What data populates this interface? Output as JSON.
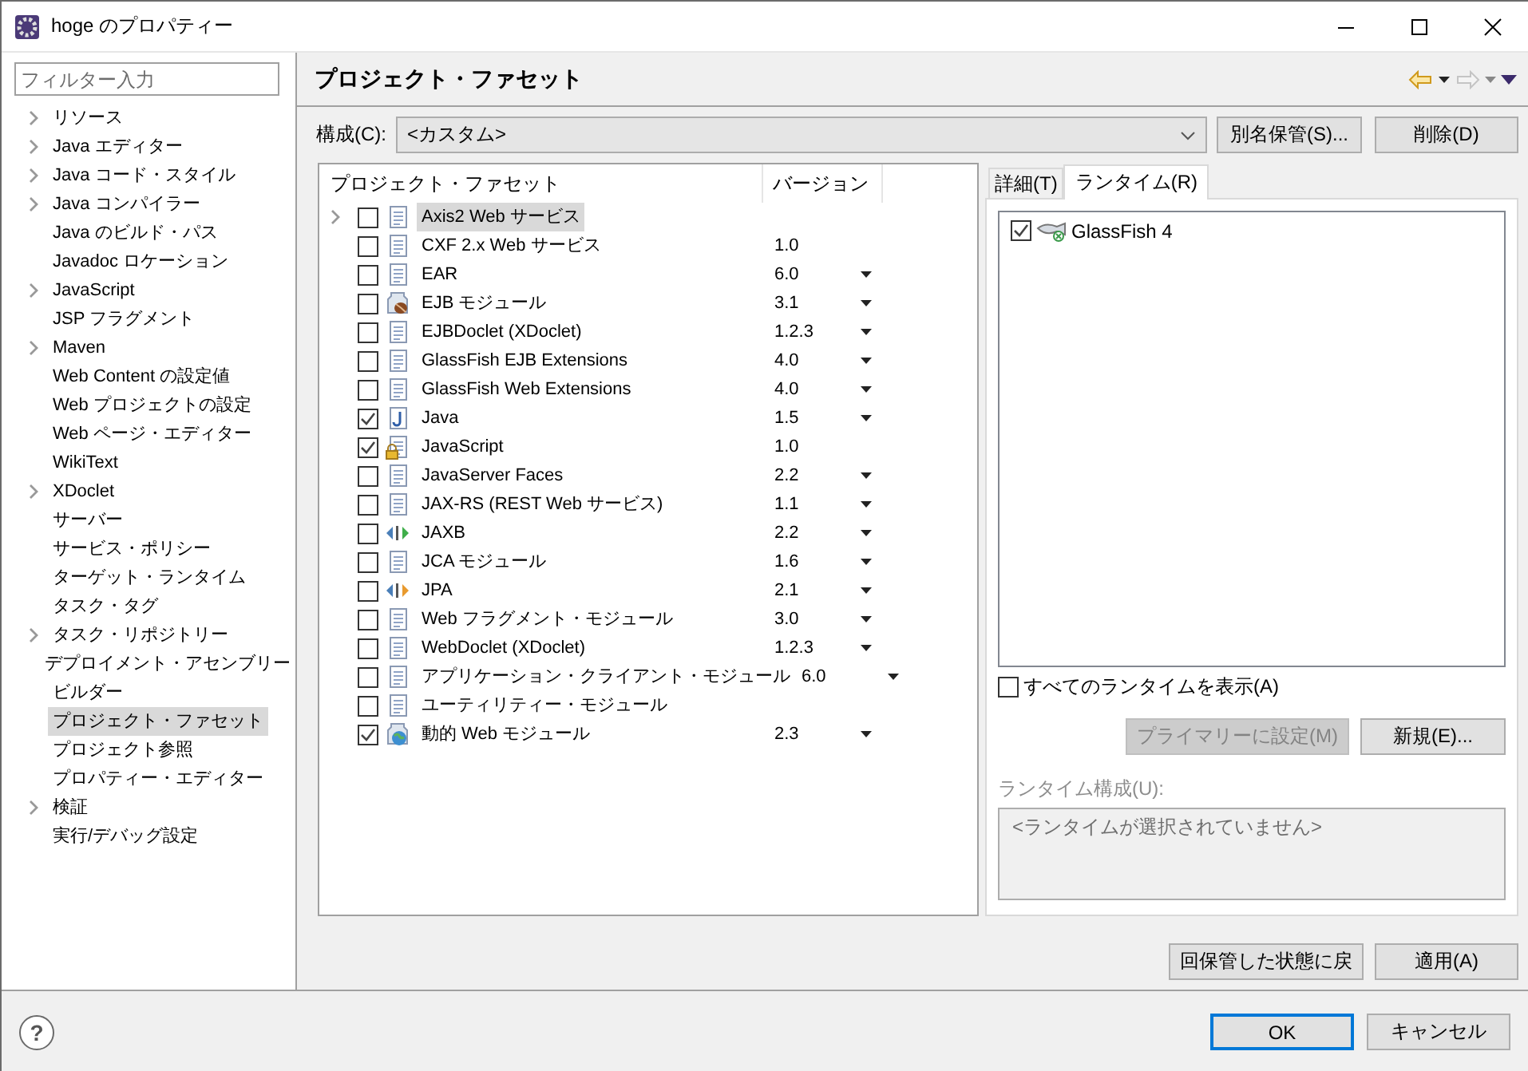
{
  "window": {
    "title": "hoge のプロパティー"
  },
  "sidebar": {
    "filter": {
      "placeholder": "フィルター入力"
    },
    "items": [
      {
        "label": "リソース",
        "expandable": true,
        "selected": false
      },
      {
        "label": "Java エディター",
        "expandable": true,
        "selected": false
      },
      {
        "label": "Java コード・スタイル",
        "expandable": true,
        "selected": false
      },
      {
        "label": "Java コンパイラー",
        "expandable": true,
        "selected": false
      },
      {
        "label": "Java のビルド・パス",
        "expandable": false,
        "selected": false
      },
      {
        "label": "Javadoc ロケーション",
        "expandable": false,
        "selected": false
      },
      {
        "label": "JavaScript",
        "expandable": true,
        "selected": false
      },
      {
        "label": "JSP フラグメント",
        "expandable": false,
        "selected": false
      },
      {
        "label": "Maven",
        "expandable": true,
        "selected": false
      },
      {
        "label": "Web Content の設定値",
        "expandable": false,
        "selected": false
      },
      {
        "label": "Web プロジェクトの設定",
        "expandable": false,
        "selected": false
      },
      {
        "label": "Web ページ・エディター",
        "expandable": false,
        "selected": false
      },
      {
        "label": "WikiText",
        "expandable": false,
        "selected": false
      },
      {
        "label": "XDoclet",
        "expandable": true,
        "selected": false
      },
      {
        "label": "サーバー",
        "expandable": false,
        "selected": false
      },
      {
        "label": "サービス・ポリシー",
        "expandable": false,
        "selected": false
      },
      {
        "label": "ターゲット・ランタイム",
        "expandable": false,
        "selected": false
      },
      {
        "label": "タスク・タグ",
        "expandable": false,
        "selected": false
      },
      {
        "label": "タスク・リポジトリー",
        "expandable": true,
        "selected": false
      },
      {
        "label": "デプロイメント・アセンブリー",
        "expandable": false,
        "selected": false
      },
      {
        "label": "ビルダー",
        "expandable": false,
        "selected": false
      },
      {
        "label": "プロジェクト・ファセット",
        "expandable": false,
        "selected": true
      },
      {
        "label": "プロジェクト参照",
        "expandable": false,
        "selected": false
      },
      {
        "label": "プロパティー・エディター",
        "expandable": false,
        "selected": false
      },
      {
        "label": "検証",
        "expandable": true,
        "selected": false
      },
      {
        "label": "実行/デバッグ設定",
        "expandable": false,
        "selected": false
      }
    ]
  },
  "page": {
    "title": "プロジェクト・ファセット"
  },
  "configuration": {
    "label": "構成(C):",
    "value": "<カスタム>",
    "buttons": [
      {
        "label": "別名保管(S)..."
      },
      {
        "label": "削除(D)"
      }
    ]
  },
  "facets": {
    "columns": [
      "プロジェクト・ファセット",
      "バージョン"
    ],
    "rows": [
      {
        "name": "Axis2 Web サービス",
        "kind": "doc",
        "checked": false,
        "selected": true,
        "expandable": true,
        "has_dropdown": false
      },
      {
        "name": "CXF 2.x Web サービス",
        "version": "1.0",
        "kind": "doc",
        "checked": false,
        "selected": false,
        "expandable": false,
        "has_dropdown": false
      },
      {
        "name": "EAR",
        "version": "6.0",
        "kind": "doc",
        "checked": false,
        "selected": false,
        "expandable": false,
        "has_dropdown": true
      },
      {
        "name": "EJB モジュール",
        "version": "3.1",
        "kind": "bean",
        "checked": false,
        "selected": false,
        "expandable": false,
        "has_dropdown": true
      },
      {
        "name": "EJBDoclet (XDoclet)",
        "version": "1.2.3",
        "kind": "doc",
        "checked": false,
        "selected": false,
        "expandable": false,
        "has_dropdown": true
      },
      {
        "name": "GlassFish EJB Extensions",
        "version": "4.0",
        "kind": "doc",
        "checked": false,
        "selected": false,
        "expandable": false,
        "has_dropdown": true
      },
      {
        "name": "GlassFish Web Extensions",
        "version": "4.0",
        "kind": "doc",
        "checked": false,
        "selected": false,
        "expandable": false,
        "has_dropdown": true
      },
      {
        "name": "Java",
        "version": "1.5",
        "kind": "java",
        "checked": true,
        "selected": false,
        "expandable": false,
        "has_dropdown": true
      },
      {
        "name": "JavaScript",
        "version": "1.0",
        "kind": "locked",
        "checked": true,
        "selected": false,
        "expandable": false,
        "has_dropdown": false
      },
      {
        "name": "JavaServer Faces",
        "version": "2.2",
        "kind": "doc",
        "checked": false,
        "selected": false,
        "expandable": false,
        "has_dropdown": true
      },
      {
        "name": "JAX-RS (REST Web サービス)",
        "version": "1.1",
        "kind": "doc",
        "checked": false,
        "selected": false,
        "expandable": false,
        "has_dropdown": true
      },
      {
        "name": "JAXB",
        "version": "2.2",
        "kind": "arrows_green",
        "checked": false,
        "selected": false,
        "expandable": false,
        "has_dropdown": true
      },
      {
        "name": "JCA モジュール",
        "version": "1.6",
        "kind": "doc",
        "checked": false,
        "selected": false,
        "expandable": false,
        "has_dropdown": true
      },
      {
        "name": "JPA",
        "version": "2.1",
        "kind": "arrows_orange",
        "checked": false,
        "selected": false,
        "expandable": false,
        "has_dropdown": true
      },
      {
        "name": "Web フラグメント・モジュール",
        "version": "3.0",
        "kind": "doc",
        "checked": false,
        "selected": false,
        "expandable": false,
        "has_dropdown": true
      },
      {
        "name": "WebDoclet (XDoclet)",
        "version": "1.2.3",
        "kind": "doc",
        "checked": false,
        "selected": false,
        "expandable": false,
        "has_dropdown": true
      },
      {
        "name": "アプリケーション・クライアント・モジュール",
        "version": "6.0",
        "kind": "doc",
        "checked": false,
        "selected": false,
        "expandable": false,
        "has_dropdown": true
      },
      {
        "name": "ユーティリティー・モジュール",
        "kind": "doc",
        "checked": false,
        "selected": false,
        "expandable": false,
        "has_dropdown": false
      },
      {
        "name": "動的 Web モジュール",
        "version": "2.3",
        "kind": "globe",
        "checked": true,
        "selected": false,
        "expandable": false,
        "has_dropdown": true
      }
    ]
  },
  "details": {
    "tabs": [
      {
        "label": "詳細(T)",
        "selected": false
      },
      {
        "label": "ランタイム(R)",
        "selected": true
      }
    ],
    "runtimes": [
      {
        "name": "GlassFish 4",
        "checked": true
      }
    ],
    "show_all": {
      "label": "すべてのランタイムを表示(A)",
      "checked": false
    },
    "buttons": [
      {
        "label": "プライマリーに設定(M)",
        "disabled": true
      },
      {
        "label": "新規(E)...",
        "disabled": false
      }
    ],
    "runtime_config": {
      "label": "ランタイム構成(U):",
      "disabled": true,
      "placeholder": "<ランタイムが選択されていません>"
    }
  },
  "actions": [
    {
      "label": "回保管した状態に戻"
    },
    {
      "label": "適用(A)"
    }
  ],
  "help": {
    "label": "?"
  },
  "dialog_buttons": [
    {
      "label": "OK",
      "default": true
    },
    {
      "label": "キャンセル",
      "default": false
    }
  ]
}
